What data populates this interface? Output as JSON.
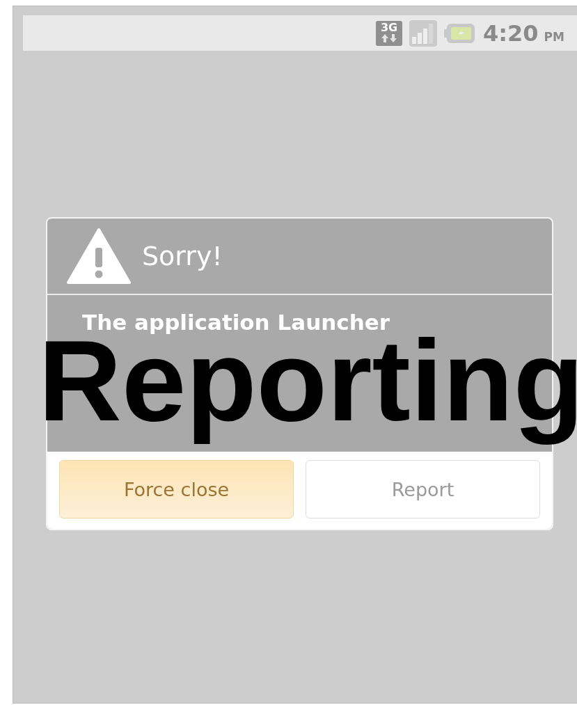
{
  "status_bar": {
    "network": "3G",
    "time": "4:20",
    "period": "PM"
  },
  "dialog": {
    "title": "Sorry!",
    "message": "The application Launcher",
    "buttons": [
      {
        "label": "Force close",
        "kind": "primary"
      },
      {
        "label": "Report",
        "kind": "normal"
      }
    ]
  },
  "overlay_caption": "Reporting"
}
